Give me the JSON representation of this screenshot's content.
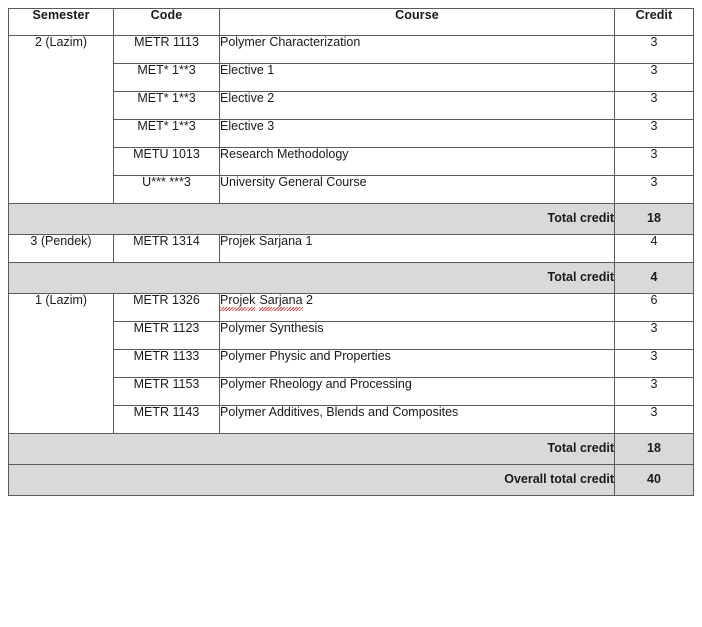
{
  "table": {
    "headers": [
      "Semester",
      "Code",
      "Course",
      "Credit"
    ],
    "groups": [
      {
        "semester": "2 (Lazim)",
        "rows": [
          {
            "code": "METR 1113",
            "course": "Polymer Characterization",
            "credit": "3",
            "spell_error": false
          },
          {
            "code": "MET* 1**3",
            "course": "Elective 1",
            "credit": "3",
            "spell_error": false
          },
          {
            "code": "MET* 1**3",
            "course": "Elective 2",
            "credit": "3",
            "spell_error": false
          },
          {
            "code": "MET* 1**3",
            "course": "Elective 3",
            "credit": "3",
            "spell_error": false
          },
          {
            "code": "METU 1013",
            "course": "Research Methodology",
            "credit": "3",
            "spell_error": false
          },
          {
            "code": "U*** ***3",
            "course": "University General Course",
            "credit": "3",
            "spell_error": false
          }
        ],
        "total_label": "Total credit",
        "total_value": "18"
      },
      {
        "semester": "3 (Pendek)",
        "rows": [
          {
            "code": "METR 1314",
            "course": "Projek Sarjana 1",
            "credit": "4",
            "spell_error": false
          }
        ],
        "total_label": "Total credit",
        "total_value": "4"
      },
      {
        "semester": "1 (Lazim)",
        "rows": [
          {
            "code": "METR 1326",
            "course": "Projek Sarjana 2",
            "credit": "6",
            "spell_error": true
          },
          {
            "code": "METR 1123",
            "course": "Polymer Synthesis",
            "credit": "3",
            "spell_error": false
          },
          {
            "code": "METR 1133",
            "course": "Polymer Physic and Properties",
            "credit": "3",
            "spell_error": false
          },
          {
            "code": "METR 1153",
            "course": "Polymer Rheology and Processing",
            "credit": "3",
            "spell_error": false
          },
          {
            "code": "METR 1143",
            "course": "Polymer Additives, Blends and Composites",
            "credit": "3",
            "spell_error": false
          }
        ],
        "total_label": "Total credit",
        "total_value": "18"
      }
    ],
    "overall": {
      "label": "Overall total credit",
      "value": "40"
    },
    "colors": {
      "header_background": "#d9d9d9",
      "total_row_background": "#d9d9d9",
      "border": "#5a5a5a",
      "text": "#1a1a1a",
      "spellcheck_underline": "#e03a3a"
    }
  }
}
